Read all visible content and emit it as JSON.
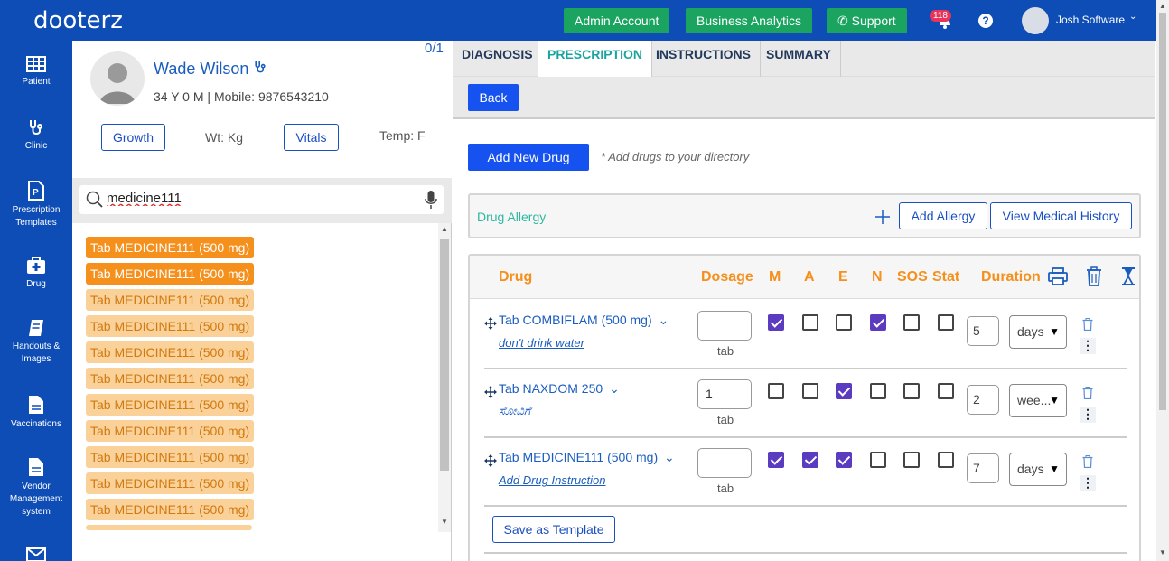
{
  "brand": "dooterz",
  "topbar": {
    "admin_label": "Admin Account",
    "analytics_label": "Business Analytics",
    "support_label": "Support",
    "notification_count": "118",
    "help_label": "?",
    "user_name": "Josh Software"
  },
  "sidebar": {
    "items": [
      {
        "label": "Patient",
        "icon": "grid-icon"
      },
      {
        "label": "Clinic",
        "icon": "stethoscope-icon"
      },
      {
        "label": "Prescription Templates",
        "icon": "prescription-icon"
      },
      {
        "label": "Drug",
        "icon": "medkit-icon"
      },
      {
        "label": "Handouts & Images",
        "icon": "book-icon"
      },
      {
        "label": "Vaccinations",
        "icon": "document-icon"
      },
      {
        "label": "Vendor Management system",
        "icon": "document-icon"
      },
      {
        "label": "",
        "icon": "mail-icon"
      }
    ]
  },
  "patient": {
    "name": "Wade Wilson",
    "info": "34 Y 0 M | Mobile: 9876543210",
    "count": "0/1",
    "growth_label": "Growth",
    "wt_label": "Wt: Kg",
    "vitals_label": "Vitals",
    "temp_label": "Temp: F"
  },
  "search": {
    "value": "medicine111"
  },
  "drug_list": [
    "Tab MEDICINE111 (500 mg)",
    "Tab MEDICINE111 (500 mg)",
    "Tab MEDICINE111 (500 mg)",
    "Tab MEDICINE111 (500 mg)",
    "Tab MEDICINE111 (500 mg)",
    "Tab MEDICINE111 (500 mg)",
    "Tab MEDICINE111 (500 mg)",
    "Tab MEDICINE111 (500 mg)",
    "Tab MEDICINE111 (500 mg)",
    "Tab MEDICINE111 (500 mg)",
    "Tab MEDICINE111 (500 mg)"
  ],
  "tabs": [
    "DIAGNOSIS",
    "PRESCRIPTION",
    "INSTRUCTIONS",
    "SUMMARY"
  ],
  "active_tab": "PRESCRIPTION",
  "back_label": "Back",
  "add_drug_label": "Add New Drug",
  "add_drug_hint": "* Add drugs to your directory",
  "allergy": {
    "label": "Drug Allergy",
    "add_label": "Add Allergy",
    "history_label": "View Medical History"
  },
  "table": {
    "headers": {
      "drug": "Drug",
      "dosage": "Dosage",
      "m": "M",
      "a": "A",
      "e": "E",
      "n": "N",
      "sos": "SOS",
      "stat": "Stat",
      "duration": "Duration"
    },
    "rows": [
      {
        "name": "Tab COMBIFLAM (500 mg)",
        "instruction": "don't drink water",
        "dose": "",
        "unit": "tab",
        "checks": [
          true,
          false,
          false,
          true,
          false,
          false
        ],
        "duration": "5",
        "period": "days"
      },
      {
        "name": "Tab NAXDOM 250",
        "instruction": "ಸೋವಿಗೆ",
        "dose": "1",
        "unit": "tab",
        "checks": [
          false,
          false,
          true,
          false,
          false,
          false
        ],
        "duration": "2",
        "period": "wee..."
      },
      {
        "name": "Tab MEDICINE111 (500 mg)",
        "instruction": "Add Drug Instruction",
        "dose": "",
        "unit": "tab",
        "checks": [
          true,
          true,
          true,
          false,
          false,
          false
        ],
        "duration": "7",
        "period": "days"
      }
    ]
  },
  "save_template_label": "Save as Template",
  "colors": {
    "brand_blue": "#0d4db5",
    "green": "#1aa460",
    "orange": "#f5901c",
    "purple": "#5b3bbf",
    "teal": "#1aa4a0"
  }
}
